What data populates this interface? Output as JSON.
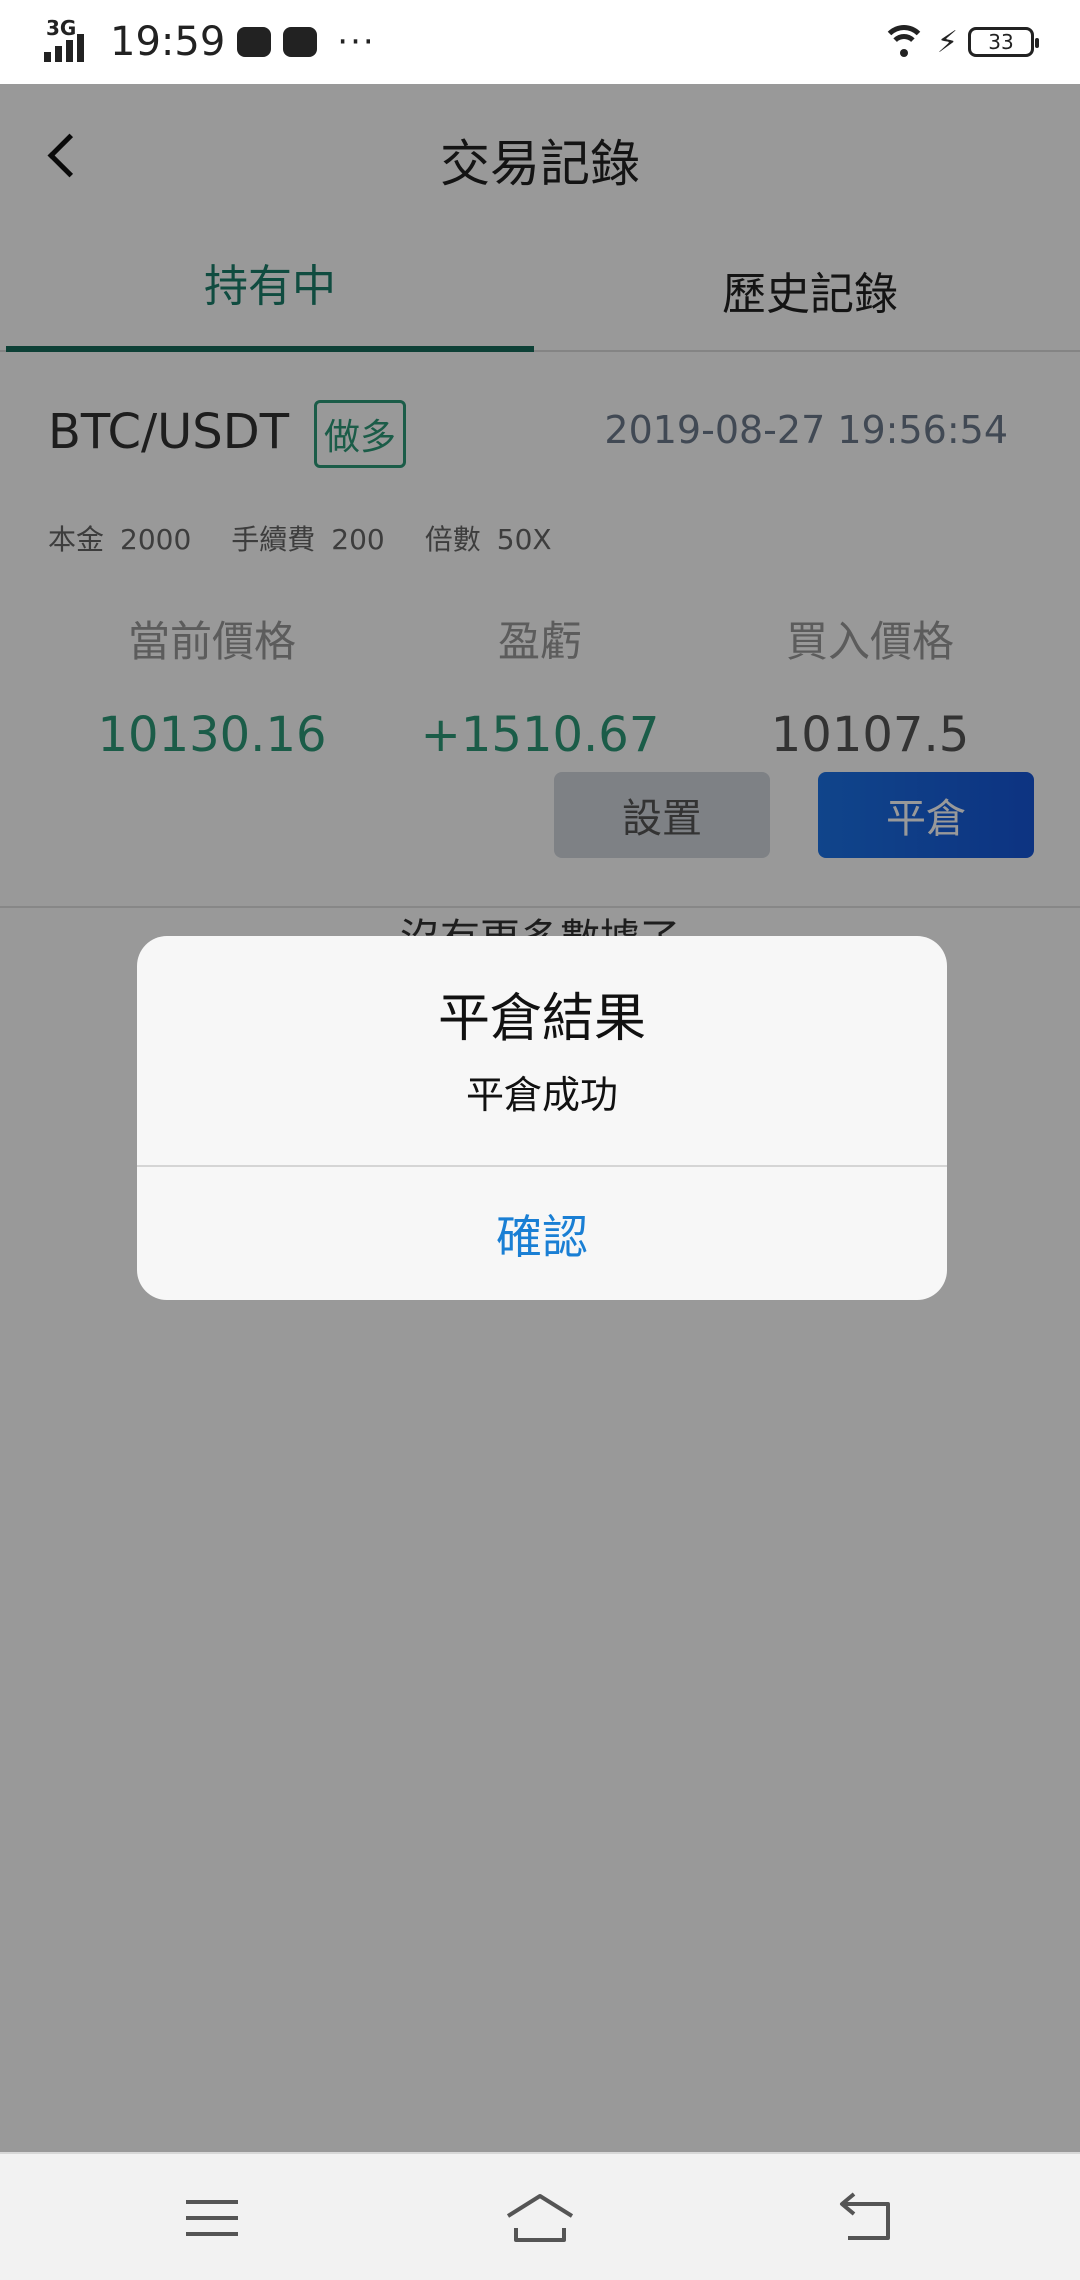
{
  "status_bar": {
    "network": "3G",
    "time": "19:59",
    "more": "···",
    "battery": "33"
  },
  "header": {
    "title": "交易記錄"
  },
  "tabs": [
    {
      "label": "持有中",
      "active": true
    },
    {
      "label": "歷史記錄",
      "active": false
    }
  ],
  "position": {
    "pair": "BTC/USDT",
    "side": "做多",
    "opened_at": "2019-08-27 19:56:54",
    "principal_label": "本金",
    "principal": "2000",
    "fee_label": "手續費",
    "fee": "200",
    "leverage_label": "倍數",
    "leverage": "50X",
    "current_price_label": "當前價格",
    "current_price": "10130.16",
    "pnl_label": "盈虧",
    "pnl": "+1510.67",
    "entry_price_label": "買入價格",
    "entry_price": "10107.5",
    "settings_label": "設置",
    "close_label": "平倉"
  },
  "list_footer": "沒有更多數據了",
  "dialog": {
    "title": "平倉結果",
    "message": "平倉成功",
    "confirm_label": "確認"
  },
  "colors": {
    "accent_green": "#2d9a78",
    "tab_underline": "#166b5b",
    "button_blue": "#1b73e8",
    "link_blue": "#1a7fd4"
  }
}
